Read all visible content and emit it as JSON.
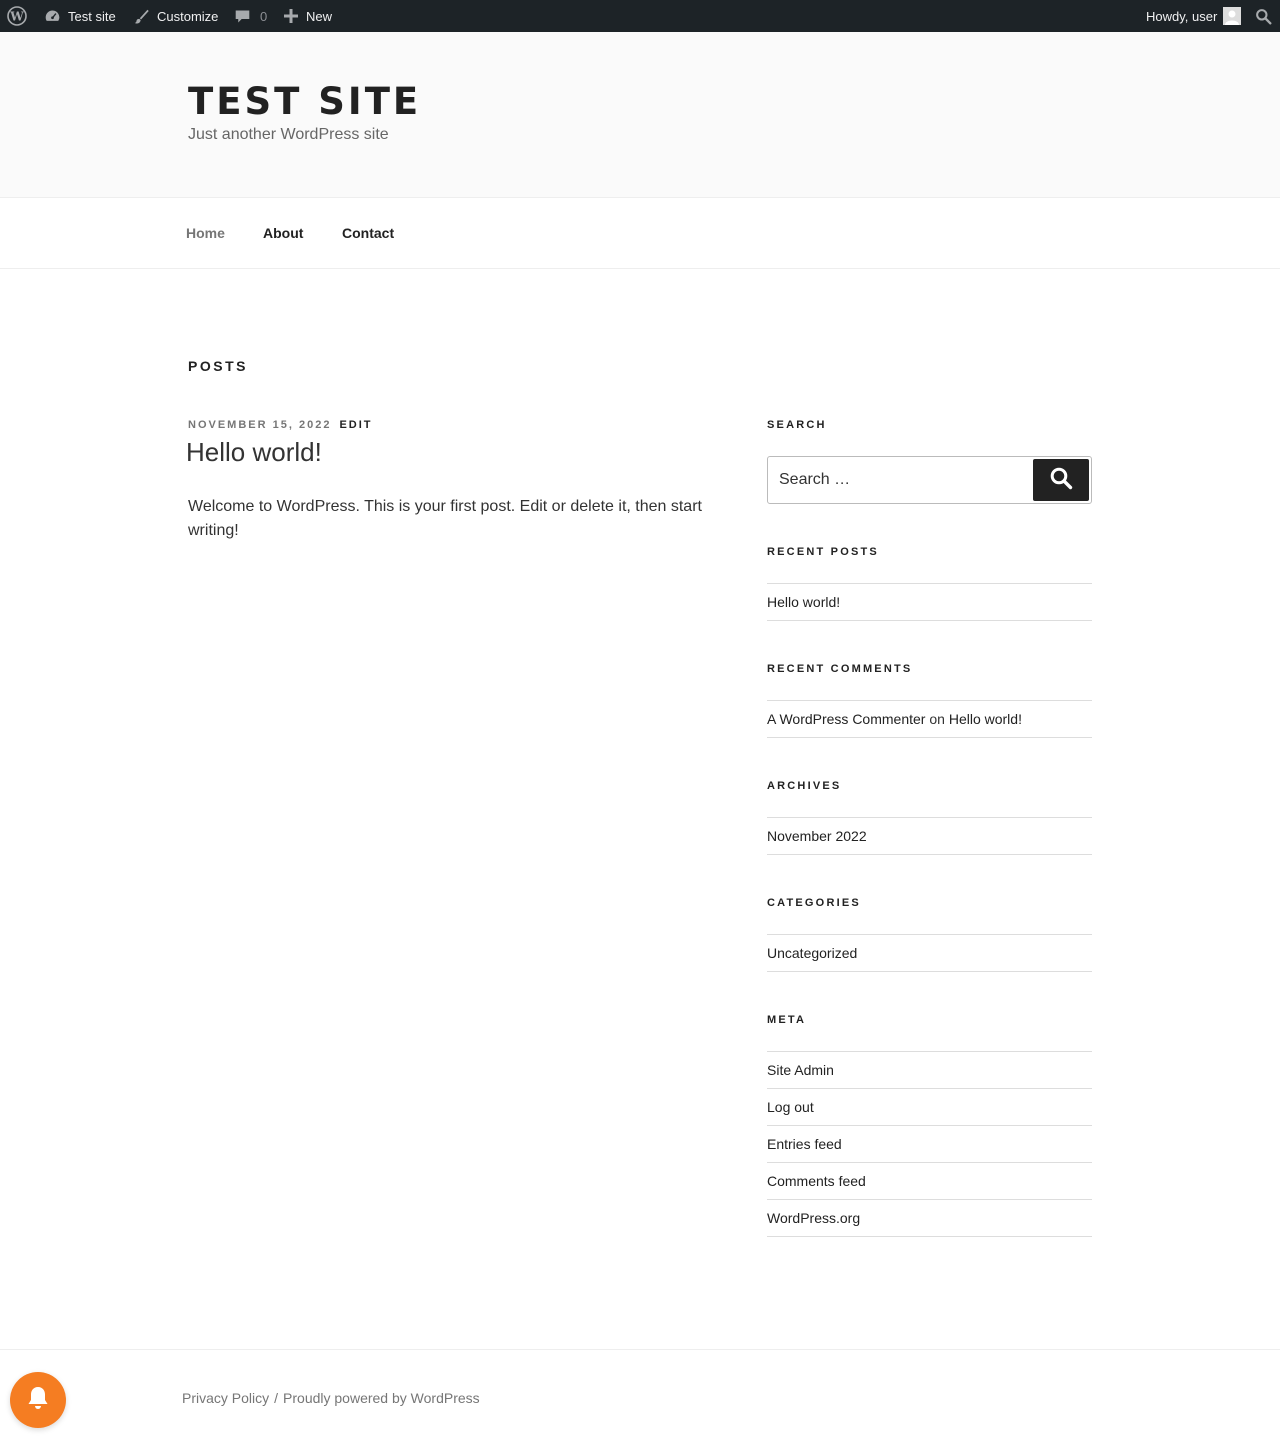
{
  "adminbar": {
    "site_name": "Test site",
    "customize": "Customize",
    "comments_count": "0",
    "new": "New",
    "howdy": "Howdy, user"
  },
  "header": {
    "title": "TEST SITE",
    "description": "Just another WordPress site"
  },
  "nav": {
    "items": [
      {
        "label": "Home",
        "current": true
      },
      {
        "label": "About"
      },
      {
        "label": "Contact"
      }
    ]
  },
  "main": {
    "page_title": "POSTS",
    "post": {
      "date": "NOVEMBER 15, 2022",
      "edit": "EDIT",
      "title": "Hello world!",
      "content": "Welcome to WordPress. This is your first post. Edit or delete it, then start writing!"
    }
  },
  "sidebar": {
    "search": {
      "title": "SEARCH",
      "placeholder": "Search …"
    },
    "recent_posts": {
      "title": "RECENT POSTS",
      "items": [
        "Hello world!"
      ]
    },
    "recent_comments": {
      "title": "RECENT COMMENTS",
      "items": [
        {
          "author": "A WordPress Commenter",
          "on": "on",
          "post": "Hello world!"
        }
      ]
    },
    "archives": {
      "title": "ARCHIVES",
      "items": [
        "November 2022"
      ]
    },
    "categories": {
      "title": "CATEGORIES",
      "items": [
        "Uncategorized"
      ]
    },
    "meta": {
      "title": "META",
      "items": [
        "Site Admin",
        "Log out",
        "Entries feed",
        "Comments feed",
        "WordPress.org"
      ]
    }
  },
  "footer": {
    "privacy": "Privacy Policy",
    "separator": "/",
    "powered": "Proudly powered by WordPress"
  },
  "colors": {
    "adminbar_bg": "#1d2327",
    "header_bg": "#fafafa",
    "notification_accent": "#f57d22"
  }
}
